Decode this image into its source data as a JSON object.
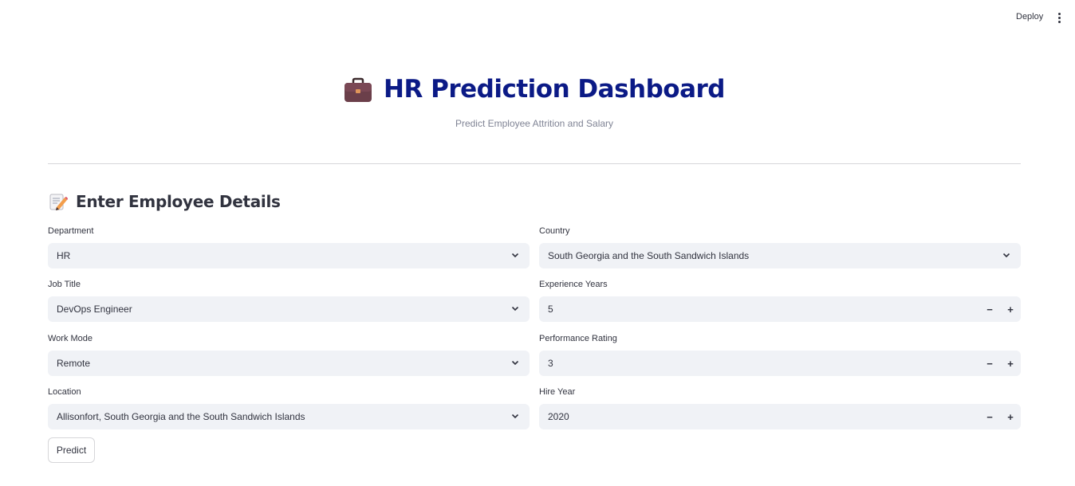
{
  "toolbar": {
    "deploy_label": "Deploy",
    "menu_icon": "kebab-menu-icon"
  },
  "header": {
    "icon": "briefcase-icon",
    "title": "HR Prediction Dashboard",
    "subtitle": "Predict Employee Attrition and Salary",
    "title_color": "#0b1a86"
  },
  "section": {
    "icon": "memo-icon",
    "title": "Enter Employee Details"
  },
  "form": {
    "department": {
      "label": "Department",
      "value": "HR"
    },
    "country": {
      "label": "Country",
      "value": "South Georgia and the South Sandwich Islands"
    },
    "job_title": {
      "label": "Job Title",
      "value": "DevOps Engineer"
    },
    "experience_years": {
      "label": "Experience Years",
      "value": "5"
    },
    "work_mode": {
      "label": "Work Mode",
      "value": "Remote"
    },
    "performance_rating": {
      "label": "Performance Rating",
      "value": "3"
    },
    "location": {
      "label": "Location",
      "value": "Allisonfort, South Georgia and the South Sandwich Islands"
    },
    "hire_year": {
      "label": "Hire Year",
      "value": "2020"
    },
    "stepper_minus": "−",
    "stepper_plus": "+"
  },
  "actions": {
    "predict_label": "Predict"
  }
}
